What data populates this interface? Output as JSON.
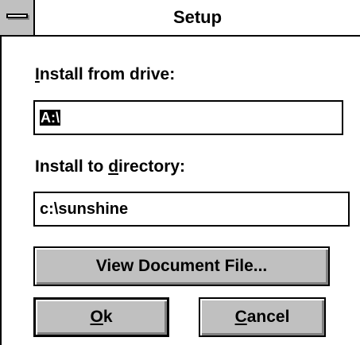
{
  "window": {
    "title": "Setup"
  },
  "install_from": {
    "label_ul": "I",
    "label_rest": "nstall from drive:",
    "value": "A:\\"
  },
  "install_to": {
    "label_pre": "Install to ",
    "label_ul": "d",
    "label_post": "irectory:",
    "value": "c:\\sunshine"
  },
  "buttons": {
    "view_doc": "View Document File...",
    "ok_ul": "O",
    "ok_rest": "k",
    "cancel_ul": "C",
    "cancel_rest": "ancel"
  },
  "icons": {
    "system_menu": "system-menu-icon"
  }
}
